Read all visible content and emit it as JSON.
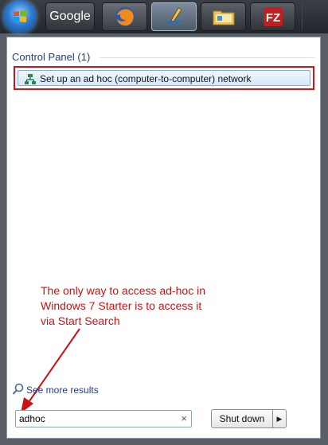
{
  "taskbar": {
    "google_label": "Google",
    "icons": [
      "windows-orb-icon",
      "google-icon",
      "firefox-icon",
      "paint-icon",
      "folder-icon",
      "filezilla-icon"
    ]
  },
  "results": {
    "header": "Control Panel (1)",
    "items": [
      {
        "label": "Set up an ad hoc (computer-to-computer) network",
        "icon": "network-icon"
      }
    ]
  },
  "annotation": {
    "lines": [
      "The only way to access ad-hoc in",
      "Windows 7 Starter is to access it",
      "via Start Search"
    ],
    "color": "#cc1111"
  },
  "see_more": {
    "label": "See more results"
  },
  "search": {
    "value": "adhoc",
    "clear_glyph": "×"
  },
  "shutdown": {
    "label": "Shut down",
    "arrow": "▶"
  },
  "colors": {
    "accent": "#1e3e8a",
    "highlight_border": "#d0121b"
  }
}
